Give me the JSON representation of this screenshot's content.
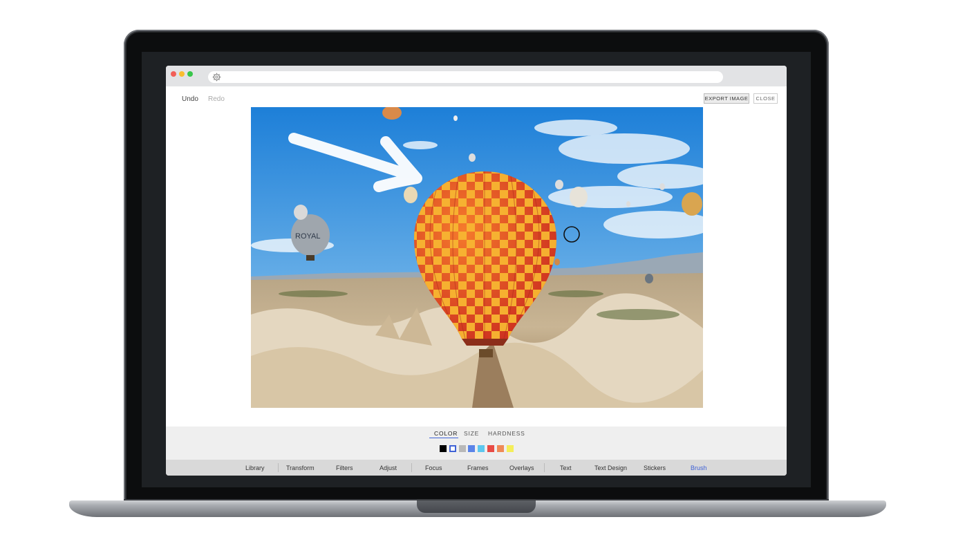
{
  "toolbar": {
    "undo_label": "Undo",
    "redo_label": "Redo",
    "export_label": "EXPORT IMAGE",
    "close_label": "CLOSE"
  },
  "brush_tabs": [
    {
      "label": "COLOR",
      "active": true
    },
    {
      "label": "SIZE",
      "active": false
    },
    {
      "label": "HARDNESS",
      "active": false
    }
  ],
  "swatches": [
    "#000000",
    "#ffffff",
    "#b8b8b8",
    "#5b84e8",
    "#5ec7ee",
    "#e84b45",
    "#ef8a57",
    "#f4ee5a"
  ],
  "selected_swatch": "#ffffff",
  "tools": [
    "Library",
    "Transform",
    "Filters",
    "Adjust",
    "Focus",
    "Frames",
    "Overlays",
    "Text",
    "Text Design",
    "Stickers",
    "Brush"
  ],
  "active_tool": "Brush",
  "colors": {
    "accent": "#3f62d6",
    "titlebar": "#e2e3e5"
  },
  "icons": {
    "url": "settings-gear-icon",
    "cursor": "brush-cursor-icon"
  }
}
